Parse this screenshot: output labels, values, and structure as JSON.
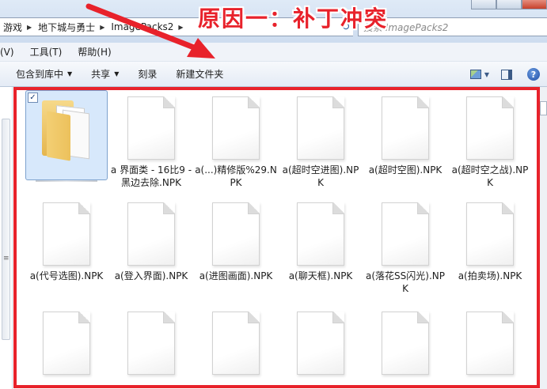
{
  "window": {
    "breadcrumbs": [
      "游戏",
      "地下城与勇士",
      "ImagePacks2"
    ],
    "search_placeholder": "搜索 ImagePacks2",
    "refresh_glyph": "↻"
  },
  "menu": [
    "(V)",
    "工具(T)",
    "帮助(H)"
  ],
  "toolbar": {
    "include_library": "包含到库中",
    "share": "共享",
    "burn": "刻录",
    "new_folder": "新建文件夹",
    "help_glyph": "?"
  },
  "annotation": {
    "title": "原因一：补丁冲突",
    "color": "#e8222b"
  },
  "files": [
    {
      "label": "",
      "kind": "folder",
      "selected": true
    },
    {
      "label": "a 界面类 - 16比9 - 黑边去除.NPK",
      "kind": "file"
    },
    {
      "label": "a(...)精修版%29.NPK",
      "kind": "file"
    },
    {
      "label": "a(超时空进图).NPK",
      "kind": "file"
    },
    {
      "label": "a(超时空图).NPK",
      "kind": "file"
    },
    {
      "label": "a(超时空之战).NPK",
      "kind": "file"
    },
    {
      "label": "a(代号选图).NPK",
      "kind": "file"
    },
    {
      "label": "a(登入界面).NPK",
      "kind": "file"
    },
    {
      "label": "a(进图画面).NPK",
      "kind": "file"
    },
    {
      "label": "a(聊天框).NPK",
      "kind": "file"
    },
    {
      "label": "a(落花SS闪光).NPK",
      "kind": "file"
    },
    {
      "label": "a(拍卖场).NPK",
      "kind": "file"
    },
    {
      "label": "",
      "kind": "file"
    },
    {
      "label": "",
      "kind": "file"
    },
    {
      "label": "",
      "kind": "file"
    },
    {
      "label": "",
      "kind": "file"
    },
    {
      "label": "",
      "kind": "file"
    },
    {
      "label": "",
      "kind": "file"
    }
  ]
}
